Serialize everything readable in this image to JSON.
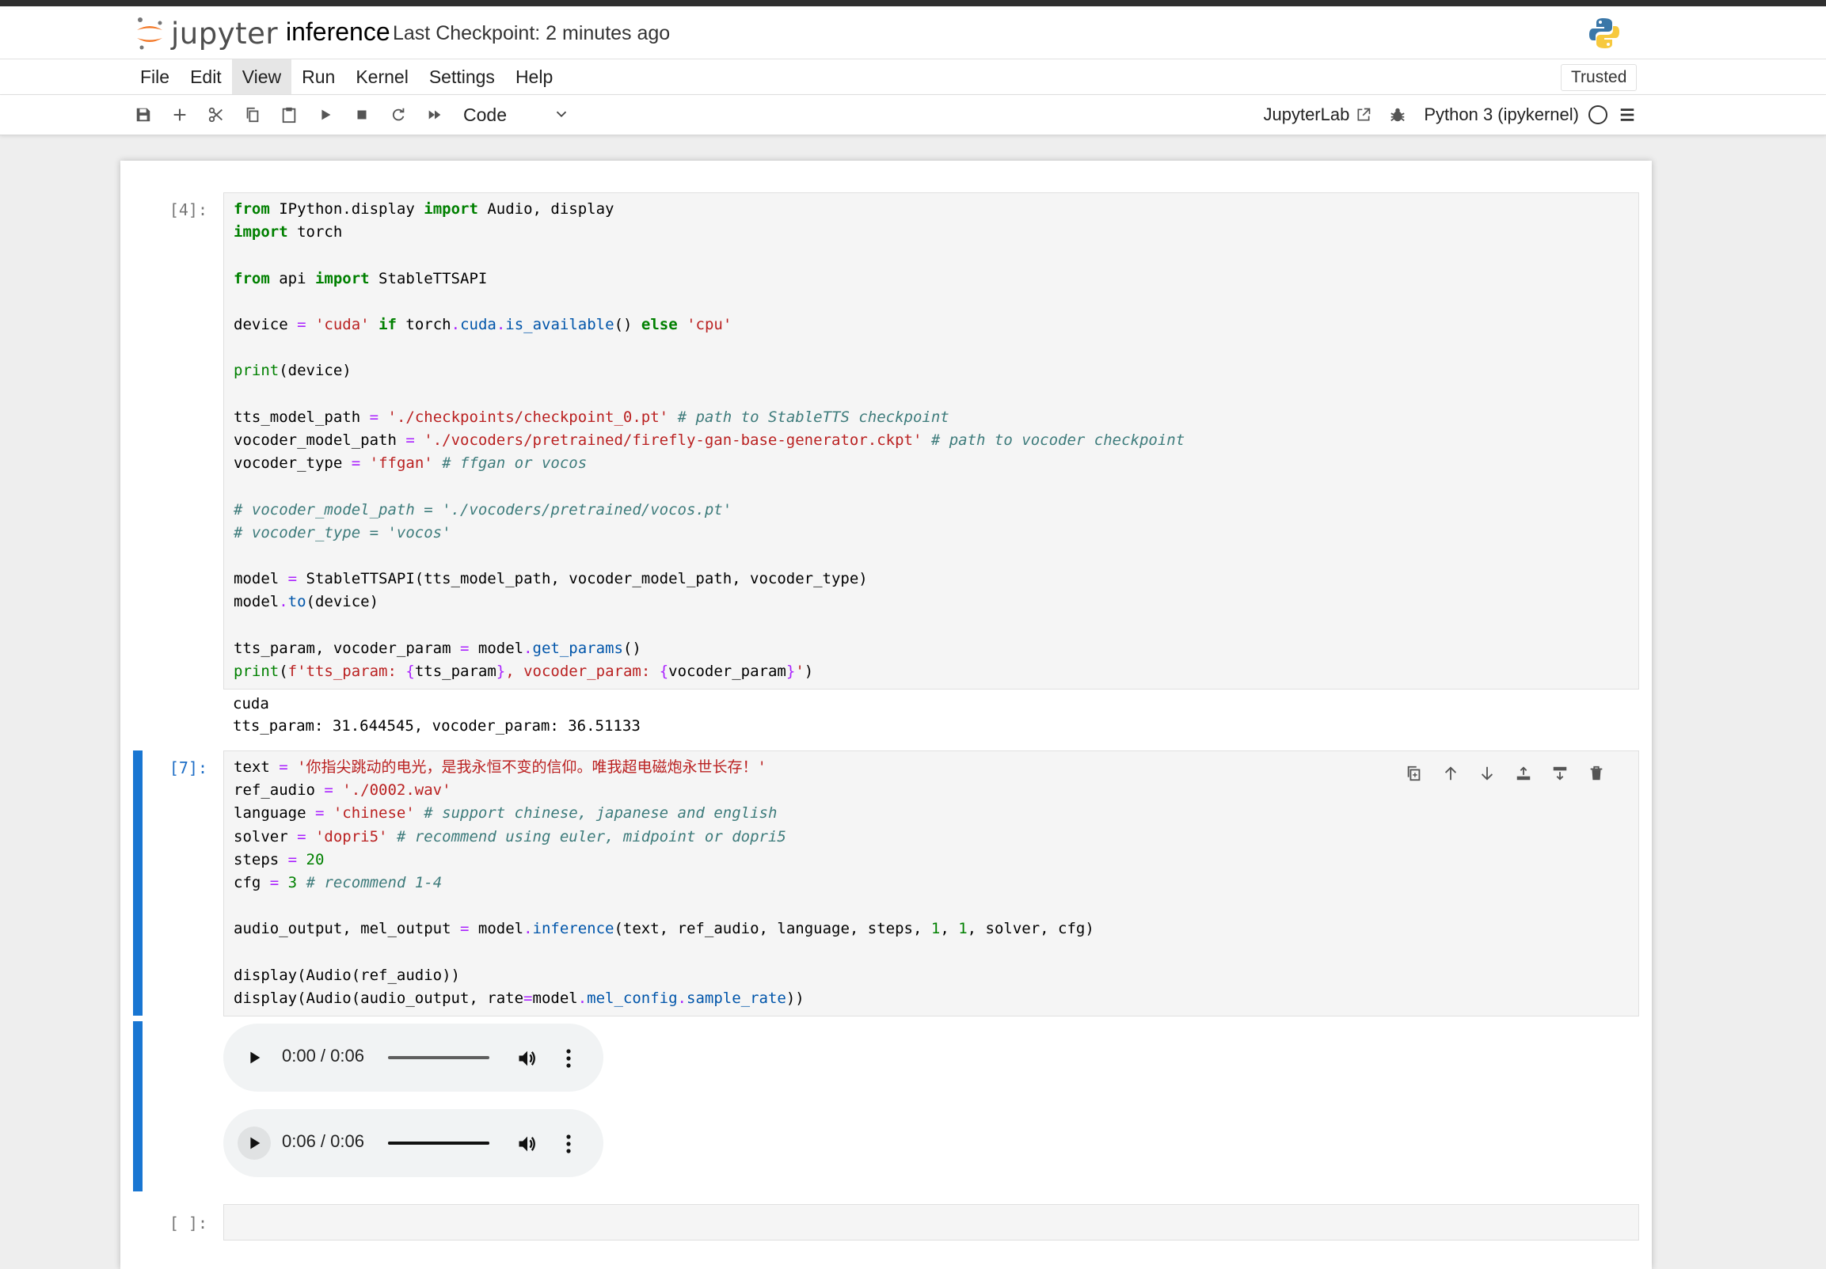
{
  "app": {
    "logo_text": "jupyter",
    "notebook_title": "inference",
    "checkpoint": "Last Checkpoint: 2 minutes ago",
    "trusted": "Trusted"
  },
  "menu": [
    "File",
    "Edit",
    "View",
    "Run",
    "Kernel",
    "Settings",
    "Help"
  ],
  "menu_active": "View",
  "toolbar": {
    "buttons": [
      "save-icon",
      "add-cell-icon",
      "cut-icon",
      "copy-icon",
      "paste-icon",
      "run-icon",
      "stop-icon",
      "restart-icon",
      "fast-forward-icon"
    ],
    "cell_type": "Code",
    "jupyterlab_link": "JupyterLab",
    "kernel_name": "Python 3 (ipykernel)"
  },
  "cells": [
    {
      "prompt": "[4]:",
      "code": [
        "from IPython.display import Audio, display",
        "import torch",
        "",
        "from api import StableTTSAPI",
        "",
        "device = 'cuda' if torch.cuda.is_available() else 'cpu'",
        "",
        "print(device)",
        "",
        "tts_model_path = './checkpoints/checkpoint_0.pt' # path to StableTTS checkpoint",
        "vocoder_model_path = './vocoders/pretrained/firefly-gan-base-generator.ckpt' # path to vocoder checkpoint",
        "vocoder_type = 'ffgan' # ffgan or vocos",
        "",
        "# vocoder_model_path = './vocoders/pretrained/vocos.pt'",
        "# vocoder_type = 'vocos'",
        "",
        "model = StableTTSAPI(tts_model_path, vocoder_model_path, vocoder_type)",
        "model.to(device)",
        "",
        "tts_param, vocoder_param = model.get_params()",
        "print(f'tts_param: {tts_param}, vocoder_param: {vocoder_param}')"
      ],
      "output": [
        "cuda",
        "tts_param: 31.644545, vocoder_param: 36.51133"
      ]
    },
    {
      "prompt": "[7]:",
      "code": [
        "text = '你指尖跳动的电光，是我永恒不变的信仰。唯我超电磁炮永世长存！'",
        "ref_audio = './0002.wav'",
        "language = 'chinese' # support chinese, japanese and english",
        "solver = 'dopri5' # recommend using euler, midpoint or dopri5",
        "steps = 20",
        "cfg = 3 # recommend 1-4",
        "",
        "audio_output, mel_output = model.inference(text, ref_audio, language, steps, 1, 1, solver, cfg)",
        "",
        "display(Audio(ref_audio))",
        "display(Audio(audio_output, rate=model.mel_config.sample_rate))"
      ],
      "cell_toolbar": [
        "duplicate-icon",
        "move-up-icon",
        "move-down-icon",
        "insert-above-icon",
        "insert-below-icon",
        "delete-icon"
      ],
      "audio_players": [
        {
          "time": "0:00 / 0:06",
          "progress": 0.0
        },
        {
          "time": "0:06 / 0:06",
          "progress": 1.0
        }
      ]
    },
    {
      "prompt": "[ ]:",
      "code": [
        ""
      ]
    }
  ],
  "colors": {
    "keyword": "#008000",
    "string": "#ba2121",
    "comment": "#3d7b7b",
    "attribute": "#0055aa",
    "active_cell": "#1976d2"
  }
}
